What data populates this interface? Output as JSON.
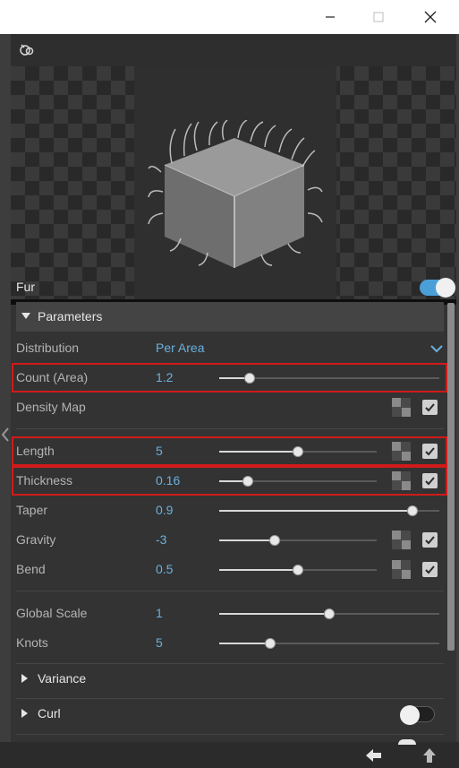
{
  "window": {
    "buttons": [
      "minimize",
      "maximize",
      "close"
    ]
  },
  "panel": {
    "fur_label": "Fur",
    "fur_enabled": true,
    "parameters_label": "Parameters",
    "distribution": {
      "label": "Distribution",
      "value": "Per Area"
    },
    "count": {
      "label": "Count (Area)",
      "value": "1.2",
      "level": 0.14
    },
    "density_map": {
      "label": "Density Map",
      "checked": true
    },
    "length": {
      "label": "Length",
      "value": "5",
      "level": 0.5,
      "checked": true
    },
    "thickness": {
      "label": "Thickness",
      "value": "0.16",
      "level": 0.18,
      "checked": true
    },
    "taper": {
      "label": "Taper",
      "value": "0.9",
      "level": 0.88
    },
    "gravity": {
      "label": "Gravity",
      "value": "-3",
      "level": 0.35,
      "checked": true
    },
    "bend": {
      "label": "Bend",
      "value": "0.5",
      "level": 0.5,
      "checked": true
    },
    "global_scale": {
      "label": "Global Scale",
      "value": "1",
      "level": 0.5
    },
    "knots": {
      "label": "Knots",
      "value": "5",
      "level": 0.23
    },
    "variance_label": "Variance",
    "curl_label": "Curl",
    "curl_enabled": false
  },
  "colors": {
    "accent": "#6ab0de",
    "toggle_on": "#4a9fd8",
    "highlight": "#d11a1a"
  },
  "icons": {
    "top_toolbar": "scene-preview-icon",
    "nav_back": "arrow-left-icon",
    "nav_up": "arrow-up-icon"
  }
}
